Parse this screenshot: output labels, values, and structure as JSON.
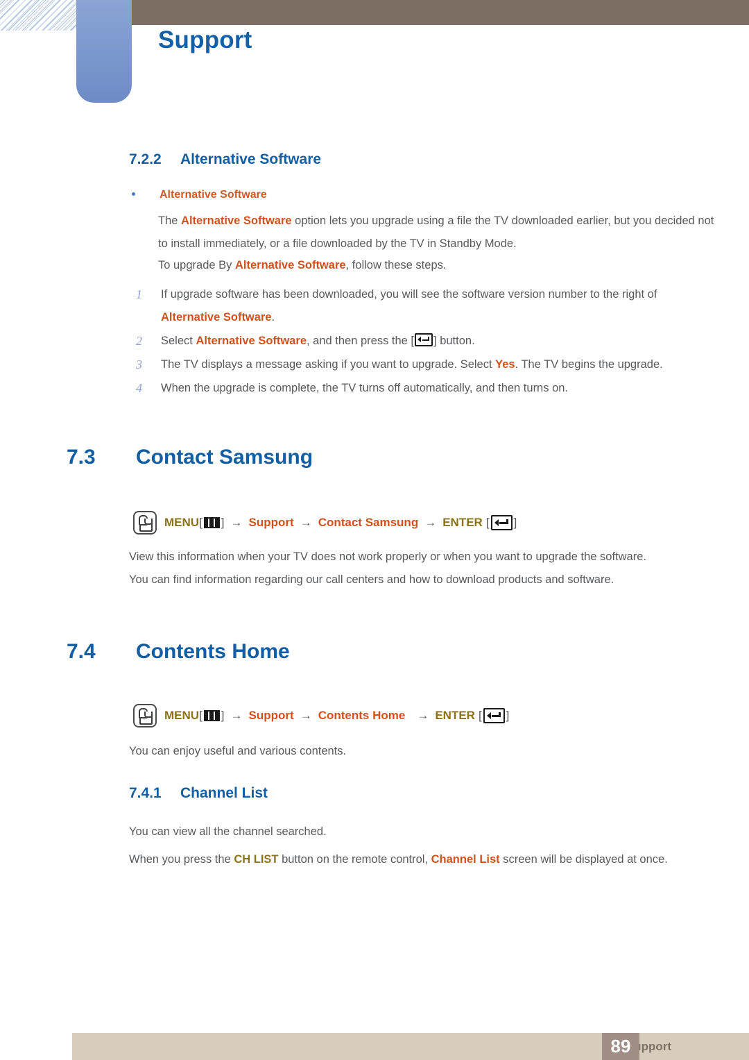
{
  "header": {
    "chapter_title": "Support",
    "brand_bar_color": "#7c6e62",
    "tab_color": "#7d99ce",
    "title_color": "#1461a8"
  },
  "colors": {
    "heading_blue": "#125ea3",
    "highlight_orange": "#d1511e",
    "key_olive": "#8b7319",
    "body_gray": "#58595b",
    "step_number_blue": "#8ea2d6",
    "footer_bg": "#d8cdbd",
    "page_box_bg": "#a08e86"
  },
  "sections": {
    "alt_software": {
      "number": "7.2.2",
      "title": "Alternative Software",
      "bullet_label": "Alternative Software",
      "para1_pre": "The ",
      "para1_hl": "Alternative Software",
      "para1_post": " option lets you upgrade using a file the TV downloaded earlier, but you decided not to install immediately, or a file downloaded by the TV in Standby Mode.",
      "para2_pre": "To upgrade By ",
      "para2_hl": "Alternative Software",
      "para2_post": ", follow these steps.",
      "steps": [
        {
          "num": "1",
          "pre": "If upgrade software has been downloaded, you will see the software version number to the right of ",
          "hl": "Alternative Software",
          "post": "."
        },
        {
          "num": "2",
          "pre": "Select ",
          "hl": "Alternative Software",
          "post": ", and then press the [",
          "icon": "enter-icon",
          "tail": "] button."
        },
        {
          "num": "3",
          "pre": "The TV displays a message asking if you want to upgrade. Select ",
          "hl": "Yes",
          "post": ". The TV begins the upgrade."
        },
        {
          "num": "4",
          "pre": "When the upgrade is complete, the TV turns off automatically, and then turns on.",
          "hl": "",
          "post": ""
        }
      ]
    },
    "contact_samsung": {
      "number": "7.3",
      "title": "Contact Samsung",
      "menu_path": {
        "touch_icon": "touch-hand-icon",
        "menu_label": "MENU",
        "menu_icon": "menu-bars-icon",
        "arrow": "→",
        "items": [
          "Support",
          "Contact Samsung"
        ],
        "enter_label": "ENTER",
        "enter_icon": "enter-icon",
        "bracket_open": "[",
        "bracket_close": "]"
      },
      "para1": "View this information when your TV does not work properly or when you want to upgrade the software.",
      "para2": "You can find information regarding our call centers and how to download products and software."
    },
    "contents_home": {
      "number": "7.4",
      "title": "Contents Home",
      "menu_path": {
        "touch_icon": "touch-hand-icon",
        "menu_label": "MENU",
        "menu_icon": "menu-bars-icon",
        "arrow": "→",
        "items": [
          "Support",
          "Contents Home"
        ],
        "enter_label": "ENTER",
        "enter_icon": "enter-icon",
        "bracket_open": "[",
        "bracket_close": "]"
      },
      "para1": "You can enjoy useful and various contents."
    },
    "channel_list": {
      "number": "7.4.1",
      "title": "Channel List",
      "para1": "You can view all the channel searched.",
      "para2_pre": "When you press the ",
      "para2_key": "CH LIST",
      "para2_mid": " button on the remote control, ",
      "para2_hl": "Channel List",
      "para2_post": " screen will be displayed at once."
    }
  },
  "footer": {
    "label": "Support",
    "page_number": "89"
  }
}
